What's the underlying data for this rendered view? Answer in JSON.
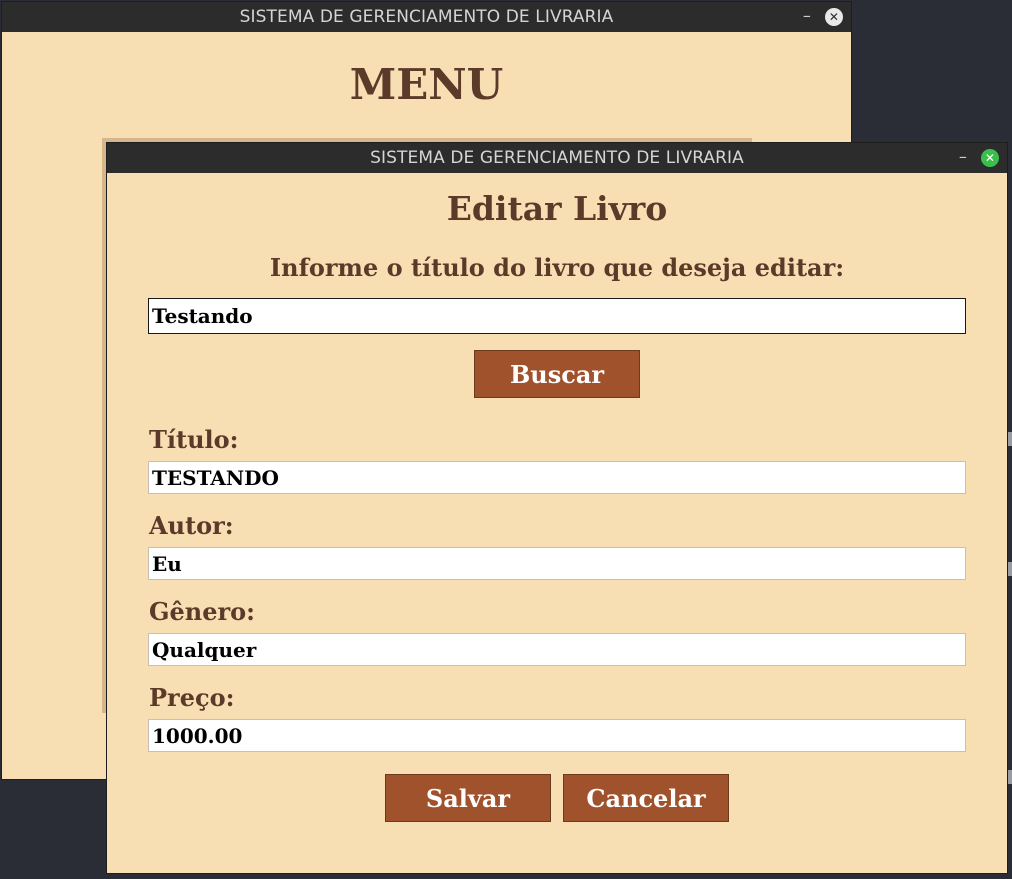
{
  "menu_window": {
    "title": "SISTEMA DE GERENCIAMENTO DE LIVRARIA",
    "heading": "MENU",
    "minimize_glyph": "–",
    "close_glyph": "✕"
  },
  "edit_window": {
    "title": "SISTEMA DE GERENCIAMENTO DE LIVRARIA",
    "minimize_glyph": "–",
    "close_glyph": "✕",
    "heading": "Editar Livro",
    "prompt": "Informe o título do livro que deseja editar:",
    "search_value": "Testando",
    "search_button": "Buscar",
    "fields": {
      "titulo": {
        "label": "Título:",
        "value": "TESTANDO"
      },
      "autor": {
        "label": "Autor:",
        "value": "Eu"
      },
      "genero": {
        "label": "Gênero:",
        "value": "Qualquer"
      },
      "preco": {
        "label": "Preço:",
        "value": "1000.00"
      }
    },
    "save_button": "Salvar",
    "cancel_button": "Cancelar"
  },
  "colors": {
    "window_bg": "#f7deb3",
    "text_brown": "#5b3a29",
    "button_bg": "#a0522d",
    "titlebar_bg": "#2c2c2c",
    "close_active": "#3bbf4c"
  }
}
